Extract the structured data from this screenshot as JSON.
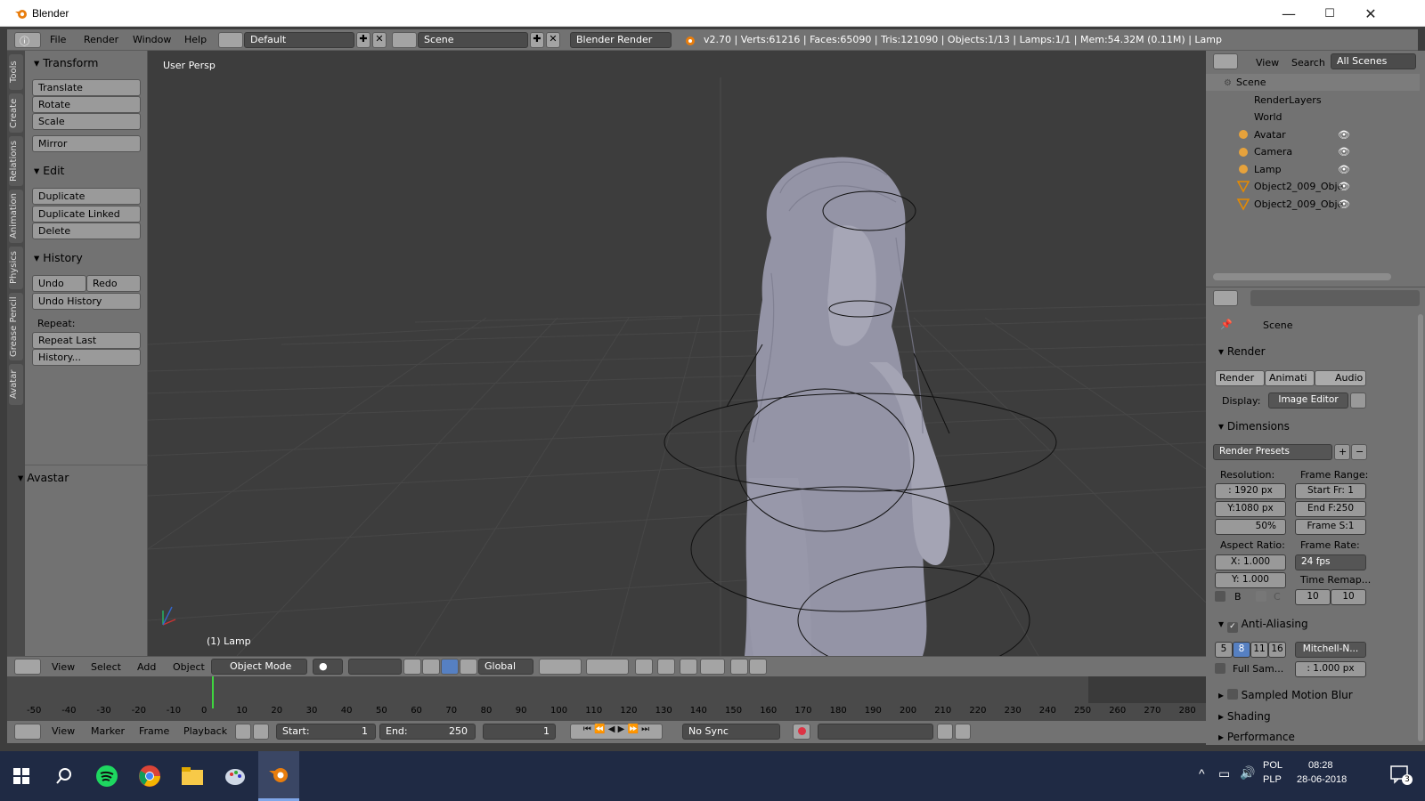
{
  "window": {
    "title": "Blender",
    "controls": [
      "—",
      "☐",
      "✕"
    ]
  },
  "info_header": {
    "menus": [
      "File",
      "Render",
      "Window",
      "Help"
    ],
    "layout": "Default",
    "scene": "Scene",
    "engine": "Blender Render",
    "stats": "v2.70 | Verts:61216 | Faces:65090 | Tris:121090 | Objects:1/13 | Lamps:1/1 | Mem:54.32M (0.11M) | Lamp"
  },
  "vertical_tabs": [
    "Tools",
    "Create",
    "Relations",
    "Animation",
    "Physics",
    "Grease Pencil",
    "Avatar"
  ],
  "tool_shelf": {
    "transform": {
      "title": "Transform",
      "buttons": [
        "Translate",
        "Rotate",
        "Scale",
        "Mirror"
      ]
    },
    "edit": {
      "title": "Edit",
      "buttons": [
        "Duplicate",
        "Duplicate Linked",
        "Delete"
      ]
    },
    "history": {
      "title": "History",
      "undo": "Undo",
      "redo": "Redo",
      "undo_history": "Undo History",
      "repeat_label": "Repeat:",
      "repeat_last": "Repeat Last",
      "history_btn": "History..."
    },
    "avastar": {
      "title": "Avastar"
    }
  },
  "viewport": {
    "label": "User Persp",
    "active_object": "(1) Lamp"
  },
  "view_header": {
    "menus": [
      "View",
      "Select",
      "Add",
      "Object"
    ],
    "mode": "Object Mode",
    "orientation": "Global"
  },
  "timeline": {
    "ticks": [
      "-50",
      "-40",
      "-30",
      "-20",
      "-10",
      "0",
      "10",
      "20",
      "30",
      "40",
      "50",
      "60",
      "70",
      "80",
      "90",
      "100",
      "110",
      "120",
      "130",
      "140",
      "150",
      "160",
      "170",
      "180",
      "190",
      "200",
      "210",
      "220",
      "230",
      "240",
      "250",
      "260",
      "270",
      "280"
    ],
    "menus": [
      "View",
      "Marker",
      "Frame",
      "Playback"
    ],
    "start_label": "Start:",
    "start": "1",
    "end_label": "End:",
    "end": "250",
    "current": "1",
    "sync": "No Sync"
  },
  "outliner": {
    "menus": [
      "View",
      "Search",
      "All Scenes"
    ],
    "items": [
      {
        "name": "Scene",
        "indent": 0
      },
      {
        "name": "RenderLayers",
        "indent": 1
      },
      {
        "name": "World",
        "indent": 1
      },
      {
        "name": "Avatar",
        "indent": 1
      },
      {
        "name": "Camera",
        "indent": 1
      },
      {
        "name": "Lamp",
        "indent": 1
      },
      {
        "name": "Object2_009_Obje",
        "indent": 1
      },
      {
        "name": "Object2_009_Obje",
        "indent": 1
      }
    ]
  },
  "properties": {
    "context": "Scene",
    "render_title": "Render",
    "render_btns": [
      "Render",
      "Animati",
      "Audio"
    ],
    "display_label": "Display:",
    "display": "Image Editor",
    "dimensions_title": "Dimensions",
    "presets": "Render Presets",
    "resolution_label": "Resolution:",
    "res_x": ": 1920 px",
    "res_y": "Y:1080 px",
    "res_pct": "50%",
    "frame_range_label": "Frame Range:",
    "start_fr": "Start Fr: 1",
    "end_fr": "End F:250",
    "frame_step": "Frame S:1",
    "aspect_label": "Aspect Ratio:",
    "aspect_x": "X:  1.000",
    "aspect_y": "Y:  1.000",
    "frame_rate_label": "Frame Rate:",
    "fps": "24 fps",
    "time_remap_label": "Time Remap...",
    "remap_old": "10",
    "remap_new": "10",
    "border_b": "B",
    "border_c": "C",
    "aa_title": "Anti-Aliasing",
    "aa_samples": [
      "5",
      "8",
      "11",
      "16"
    ],
    "aa_filter": "Mitchell-N...",
    "full_sample": "Full Sam...",
    "filter_size": ": 1.000 px",
    "motion_blur": "Sampled Motion Blur",
    "shading": "Shading",
    "performance": "Performance"
  },
  "taskbar": {
    "lang_top": "POL",
    "lang_bottom": "PLP",
    "time": "08:28",
    "date": "28-06-2018",
    "notif": "3"
  }
}
